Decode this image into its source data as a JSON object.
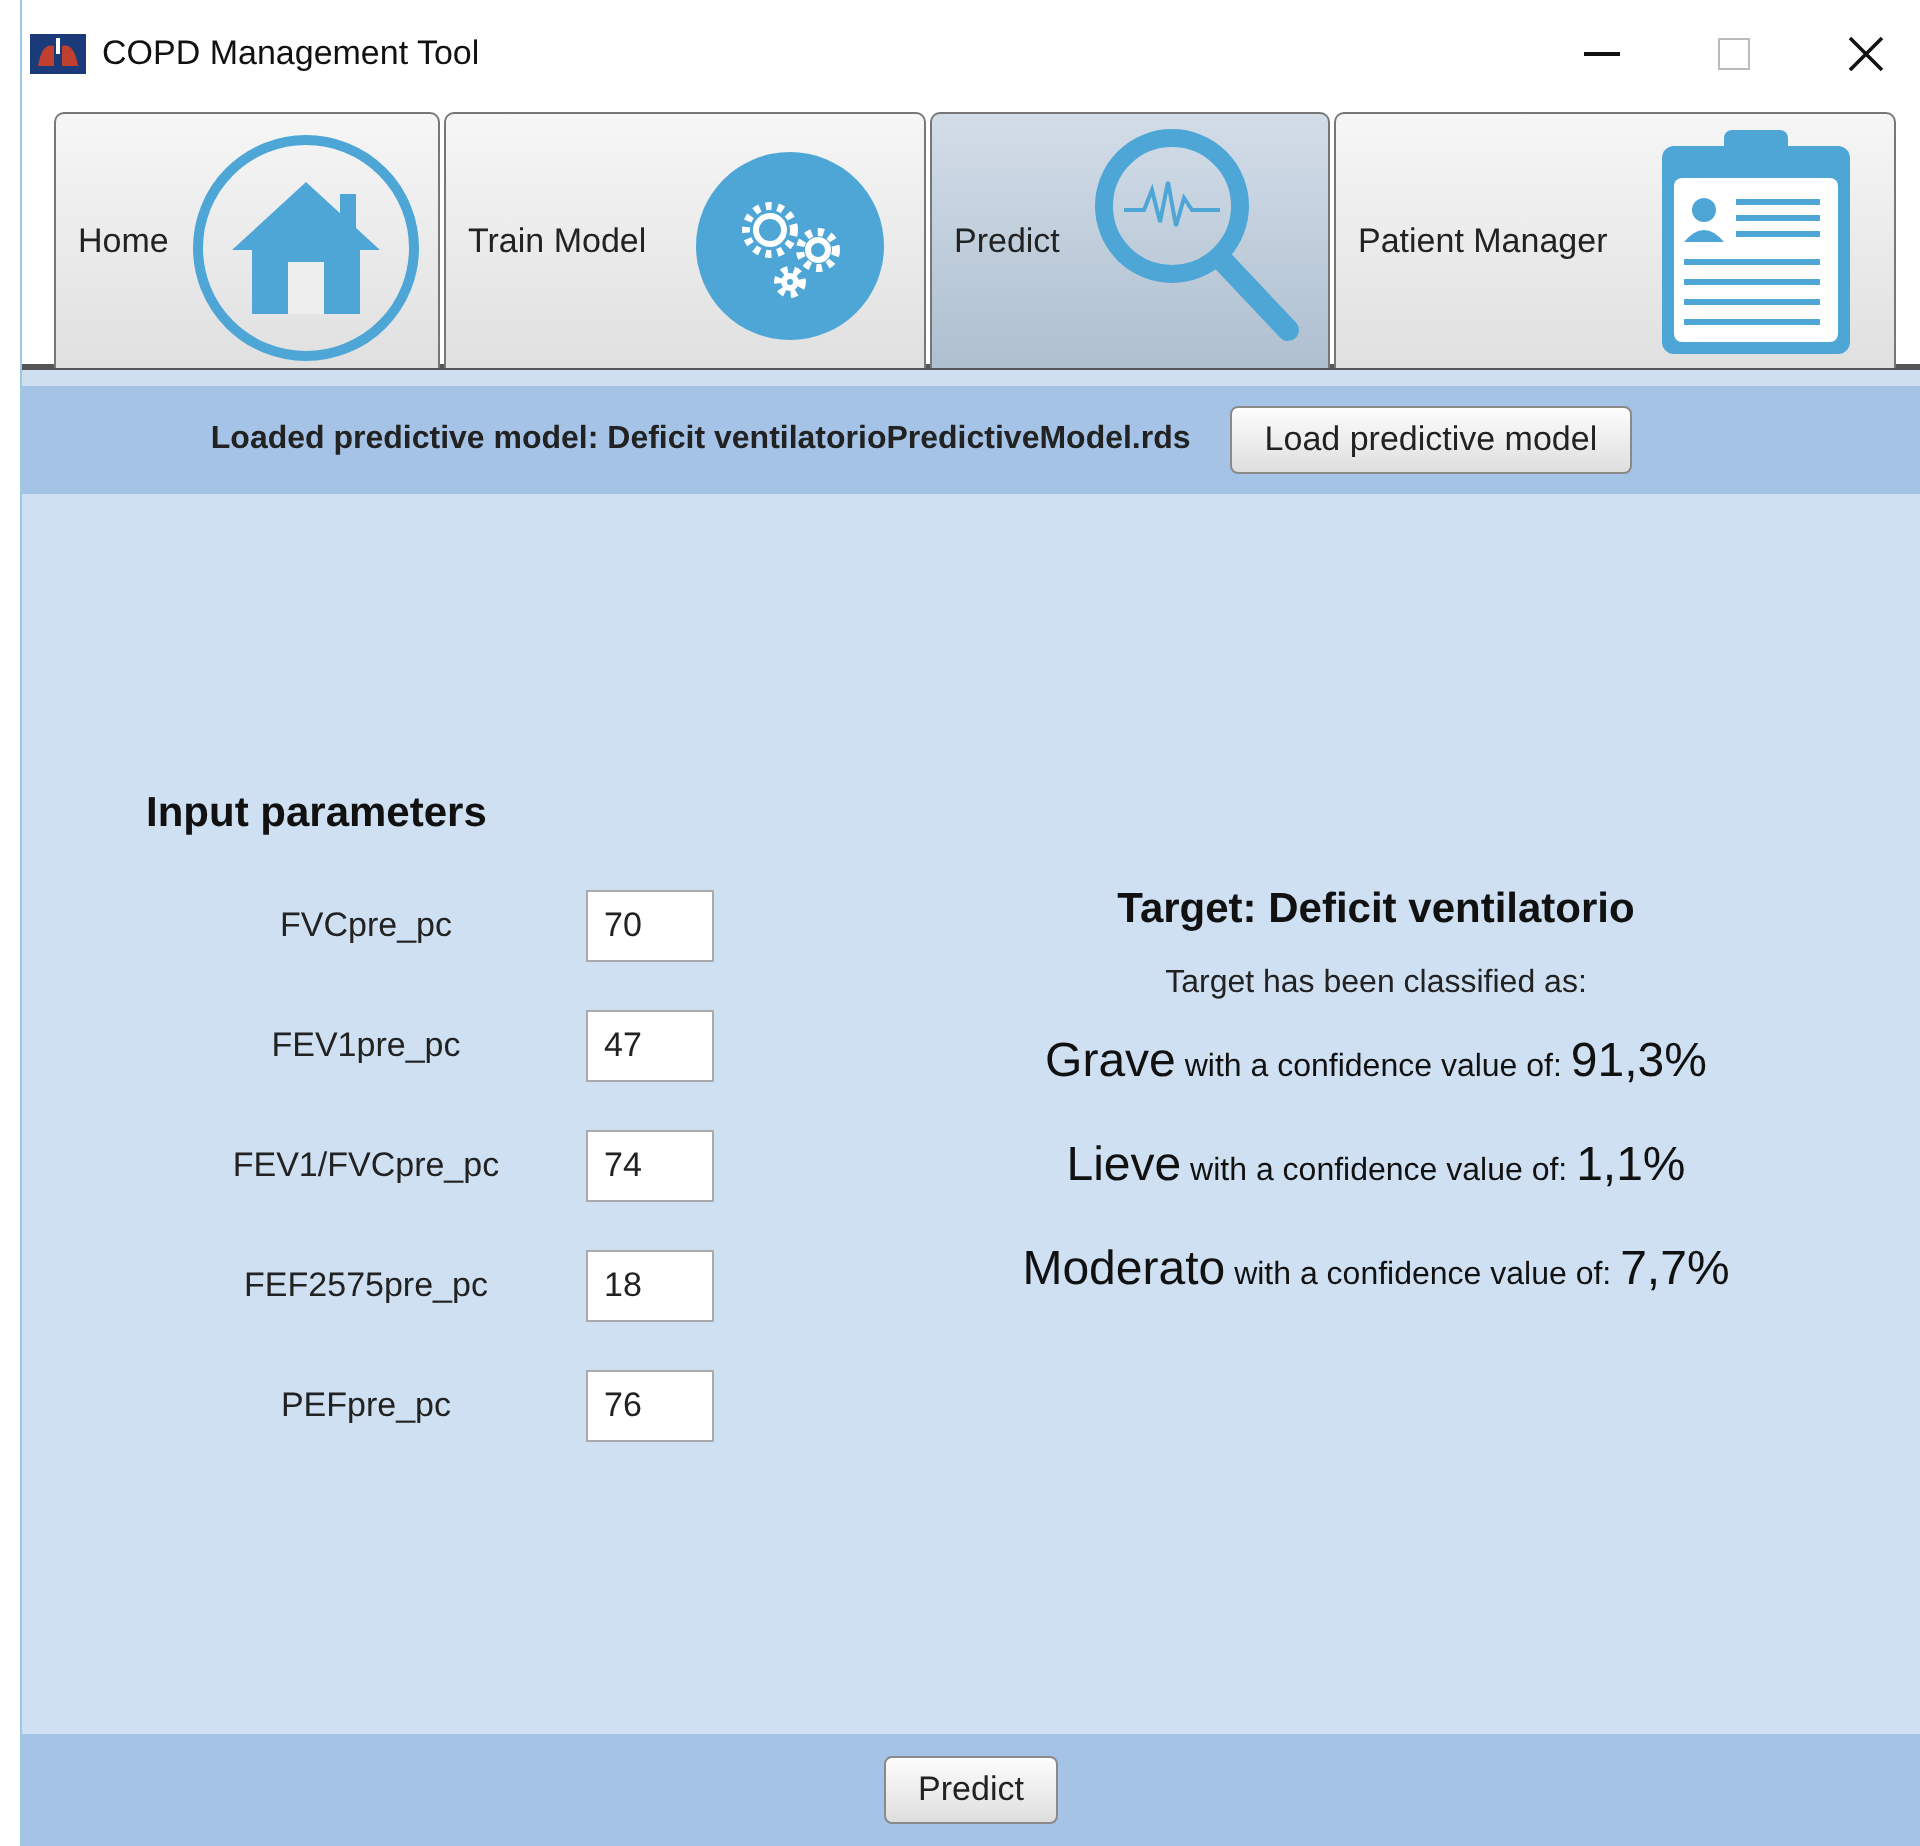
{
  "window": {
    "title": "COPD Management Tool"
  },
  "tabs": [
    {
      "label": "Home",
      "selected": false
    },
    {
      "label": "Train Model",
      "selected": false
    },
    {
      "label": "Predict",
      "selected": true
    },
    {
      "label": "Patient Manager",
      "selected": false
    }
  ],
  "model_bar": {
    "text": "Loaded predictive model: Deficit ventilatorioPredictiveModel.rds",
    "button": "Load predictive model"
  },
  "input_parameters": {
    "title": "Input parameters",
    "fields": [
      {
        "label": "FVCpre_pc",
        "value": "70"
      },
      {
        "label": "FEV1pre_pc",
        "value": "47"
      },
      {
        "label": "FEV1/FVCpre_pc",
        "value": "74"
      },
      {
        "label": "FEF2575pre_pc",
        "value": "18"
      },
      {
        "label": "PEFpre_pc",
        "value": "76"
      }
    ]
  },
  "result": {
    "title": "Target: Deficit ventilatorio",
    "subtitle": "Target has been classified as:",
    "classes": [
      {
        "class": "Grave",
        "phrase": "with a confidence value of:",
        "confidence": "91,3%"
      },
      {
        "class": "Lieve",
        "phrase": "with a confidence value of:",
        "confidence": "1,1%"
      },
      {
        "class": "Moderato",
        "phrase": "with a confidence value of:",
        "confidence": "7,7%"
      }
    ]
  },
  "buttons": [
    "Predict"
  ]
}
